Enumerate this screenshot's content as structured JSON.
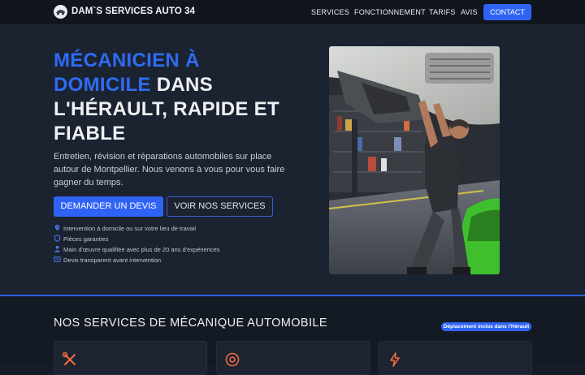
{
  "header": {
    "brand": "DAM`S SERVICES AUTO 34",
    "nav": [
      "SERVICES",
      "FONCTIONNEMENT",
      "TARIFS",
      "AVIS"
    ],
    "contact": "CONTACT"
  },
  "hero": {
    "headline_blue": "MÉCANICIEN À DOMICILE",
    "headline_rest": " DANS L'HÉRAULT, RAPIDE ET FIABLE",
    "lead": "Entretien, révision et réparations automobiles sur place autour de Montpellier. Nous venons à vous pour vous faire gagner du temps.",
    "cta_primary": "DEMANDER UN DEVIS",
    "cta_secondary": "VOIR NOS SERVICES",
    "features": [
      {
        "icon": "location-pin-icon",
        "text": "Intervention à domicile ou sur votre lieu de travail"
      },
      {
        "icon": "shield-icon",
        "text": "Pièces garanties"
      },
      {
        "icon": "person-icon",
        "text": "Main d'œuvre qualifiée avec plus de 20 ans d'expériences"
      },
      {
        "icon": "document-icon",
        "text": "Devis transparent avant intervention"
      }
    ],
    "photo": "mechanic-under-vehicle-photo"
  },
  "services": {
    "title": "NOS SERVICES DE MÉCANIQUE AUTOMOBILE",
    "badge": "Déplacement inclus dans l'Hérault",
    "cards": [
      {
        "icon": "wrench-screwdriver-icon"
      },
      {
        "icon": "brake-disc-icon"
      },
      {
        "icon": "lightning-icon"
      }
    ]
  },
  "colors": {
    "accent": "#2f63f6",
    "background": "#1b2331",
    "header": "#10151e",
    "icon_orange": "#f26a3d"
  }
}
